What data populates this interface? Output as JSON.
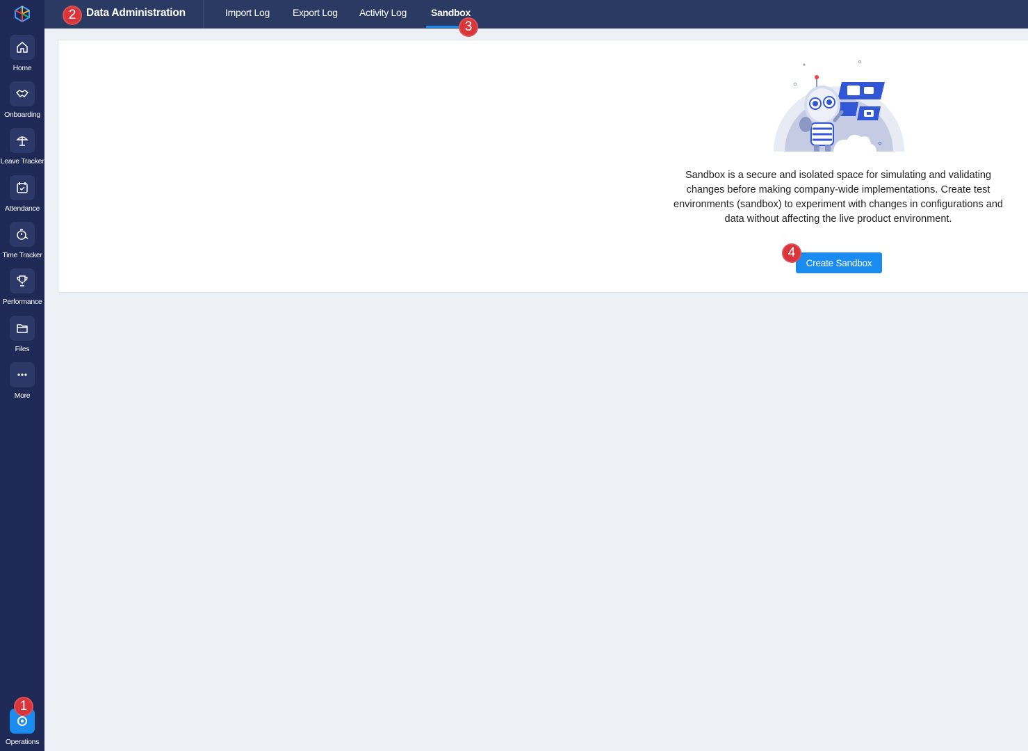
{
  "rail": {
    "items": [
      {
        "label": "Home",
        "icon": "home-icon"
      },
      {
        "label": "Onboarding",
        "icon": "handshake-icon"
      },
      {
        "label": "Leave Tracker",
        "icon": "beach-umbrella-icon"
      },
      {
        "label": "Attendance",
        "icon": "calendar-check-icon"
      },
      {
        "label": "Time Tracker",
        "icon": "stopwatch-icon"
      },
      {
        "label": "Performance",
        "icon": "trophy-icon"
      },
      {
        "label": "Files",
        "icon": "folder-icon"
      },
      {
        "label": "More",
        "icon": "more-dots-icon"
      }
    ],
    "bottom": {
      "label": "Operations",
      "icon": "operations-gear-icon"
    }
  },
  "header": {
    "title": "Data Administration",
    "tabs": [
      {
        "label": "Import Log",
        "active": false
      },
      {
        "label": "Export Log",
        "active": false
      },
      {
        "label": "Activity Log",
        "active": false
      },
      {
        "label": "Sandbox",
        "active": true
      }
    ]
  },
  "markers": [
    "1",
    "2",
    "3",
    "4"
  ],
  "sandbox": {
    "description": "Sandbox is a secure and isolated space for simulating and validating changes before making company-wide implementations. Create test environments (sandbox) to experiment with changes in configurations and data without affecting the live product environment.",
    "create_button": "Create Sandbox"
  },
  "colors": {
    "rail_bg": "#1e2a55",
    "header_bg": "#2a3a62",
    "accent": "#1a8cf0",
    "marker": "#d8363a",
    "page_bg": "#edf0f5"
  }
}
